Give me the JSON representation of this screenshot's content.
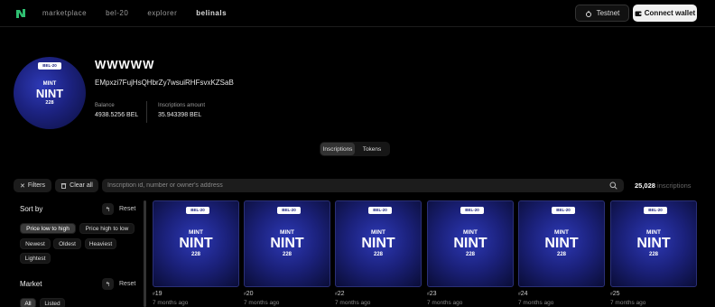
{
  "header": {
    "logo_icon": "leaf-logo-icon",
    "nav": [
      {
        "label": "marketplace",
        "active": false
      },
      {
        "label": "bel-20",
        "active": false
      },
      {
        "label": "explorer",
        "active": false
      },
      {
        "label": "belinals",
        "active": true
      }
    ],
    "network_label": "Testnet",
    "connect_label": "Connect wallet"
  },
  "profile": {
    "name": "WWWWW",
    "address": "EMpxzi7FujHsQHbrZy7wsuiRHFsvxKZSaB",
    "balance_label": "Balance",
    "balance_value": "4938.5256 BEL",
    "inscriptions_label": "Inscriptions amount",
    "inscriptions_value": "35.943398 BEL",
    "avatar": {
      "tag": "BEL-20",
      "line1": "MINT",
      "line2": "NINT",
      "line3": "228"
    }
  },
  "tabs": [
    {
      "label": "Inscriptions",
      "active": true
    },
    {
      "label": "Tokens",
      "active": false
    }
  ],
  "toolbar": {
    "filters_label": "Filters",
    "clear_label": "Clear all",
    "search_placeholder": "Inscription id, number or owner's address",
    "count_value": "25,028",
    "count_unit": "inscriptions"
  },
  "sidebar": {
    "sort_title": "Sort by",
    "sort_reset": "Reset",
    "sort_options": [
      "Price low to high",
      "Price high to low",
      "Newest",
      "Oldest",
      "Heaviest",
      "Lightest"
    ],
    "market_title": "Market",
    "market_reset": "Reset",
    "market_options": [
      "All",
      "Listed"
    ]
  },
  "cards": [
    {
      "tag": "BEL-20",
      "line1": "MINT",
      "line2": "NINT",
      "line3": "228",
      "number": "19",
      "time": "7 months ago"
    },
    {
      "tag": "BEL-20",
      "line1": "MINT",
      "line2": "NINT",
      "line3": "228",
      "number": "20",
      "time": "7 months ago"
    },
    {
      "tag": "BEL-20",
      "line1": "MINT",
      "line2": "NINT",
      "line3": "228",
      "number": "22",
      "time": "7 months ago"
    },
    {
      "tag": "BEL-20",
      "line1": "MINT",
      "line2": "NINT",
      "line3": "228",
      "number": "23",
      "time": "7 months ago"
    },
    {
      "tag": "BEL-20",
      "line1": "MINT",
      "line2": "NINT",
      "line3": "228",
      "number": "24",
      "time": "7 months ago"
    },
    {
      "tag": "BEL-20",
      "line1": "MINT",
      "line2": "NINT",
      "line3": "228",
      "number": "25",
      "time": "7 months ago"
    }
  ]
}
